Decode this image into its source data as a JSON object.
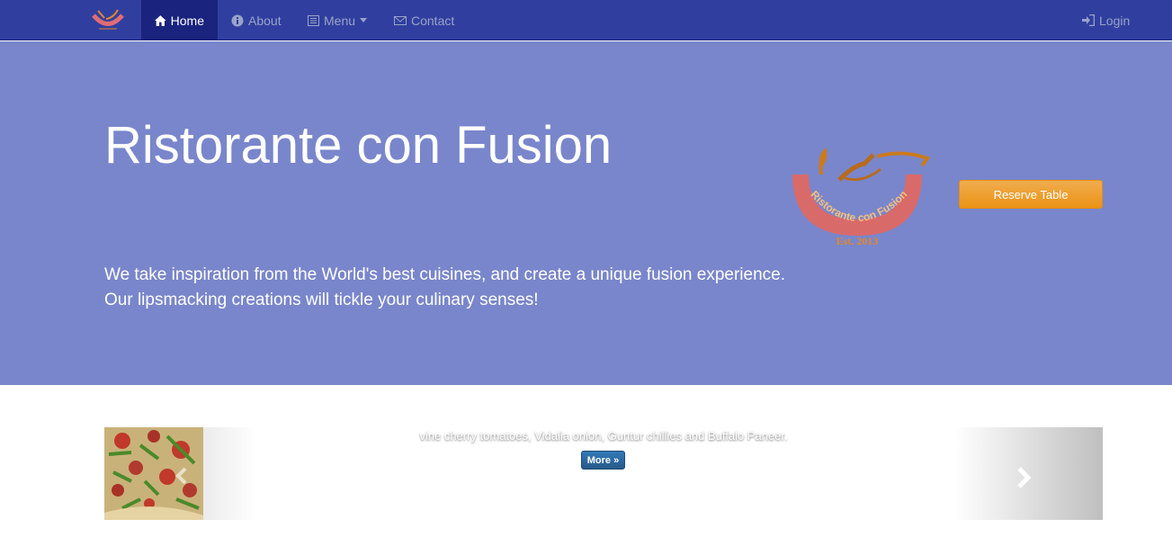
{
  "navbar": {
    "brand_icon": "restaurant-logo-icon",
    "items": [
      {
        "label": "Home",
        "icon": "home-icon",
        "active": true
      },
      {
        "label": "About",
        "icon": "info-icon",
        "active": false
      },
      {
        "label": "Menu",
        "icon": "list-icon",
        "active": false,
        "dropdown": true
      },
      {
        "label": "Contact",
        "icon": "envelope-icon",
        "active": false
      }
    ],
    "login": {
      "label": "Login",
      "icon": "login-icon"
    }
  },
  "hero": {
    "title": "Ristorante con Fusion",
    "text": "We take inspiration from the World's best cuisines, and create a unique fusion experience. Our lipsmacking creations will tickle your culinary senses!",
    "logo_text": "Ristorante con Fusion",
    "logo_est": "Est. 2013",
    "reserve_label": "Reserve Table"
  },
  "carousel": {
    "caption": "vine cherry tomatoes, Vidalia onion, Guntur chillies and Buffalo Paneer.",
    "more_label": "More »"
  },
  "colors": {
    "navbar": "#303f9f",
    "navbar_active": "#1a237e",
    "jumbotron": "#7986cb",
    "reserve_button": "#f0ad4e",
    "more_button": "#337ab7"
  }
}
